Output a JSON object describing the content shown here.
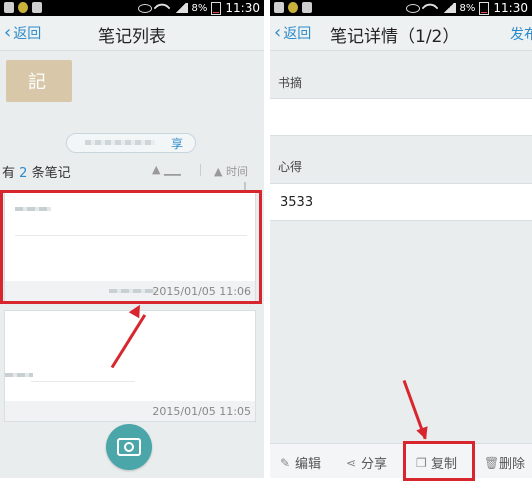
{
  "status_bar": {
    "battery": "8%",
    "time": "11:30"
  },
  "left_screen": {
    "back_label": "返回",
    "title": "笔记列表",
    "share_label": "享",
    "count_prefix": "有",
    "count": "2",
    "count_suffix": "条笔记",
    "sort_time": "时间",
    "notes": [
      {
        "timestamp": "2015/01/05 11:06"
      },
      {
        "timestamp": "2015/01/05 11:05"
      }
    ]
  },
  "right_screen": {
    "back_label": "返回",
    "title": "笔记详情（1/2）",
    "publish_label": "发布",
    "excerpt_label": "书摘",
    "excerpt_value": "",
    "thoughts_label": "心得",
    "thoughts_value": "3533",
    "toolbar": {
      "edit": "编辑",
      "share": "分享",
      "copy": "复制",
      "delete": "删除"
    }
  },
  "colors": {
    "accent": "#2e8bc9",
    "highlight": "#d7262e",
    "camera": "#4aa6a9"
  }
}
